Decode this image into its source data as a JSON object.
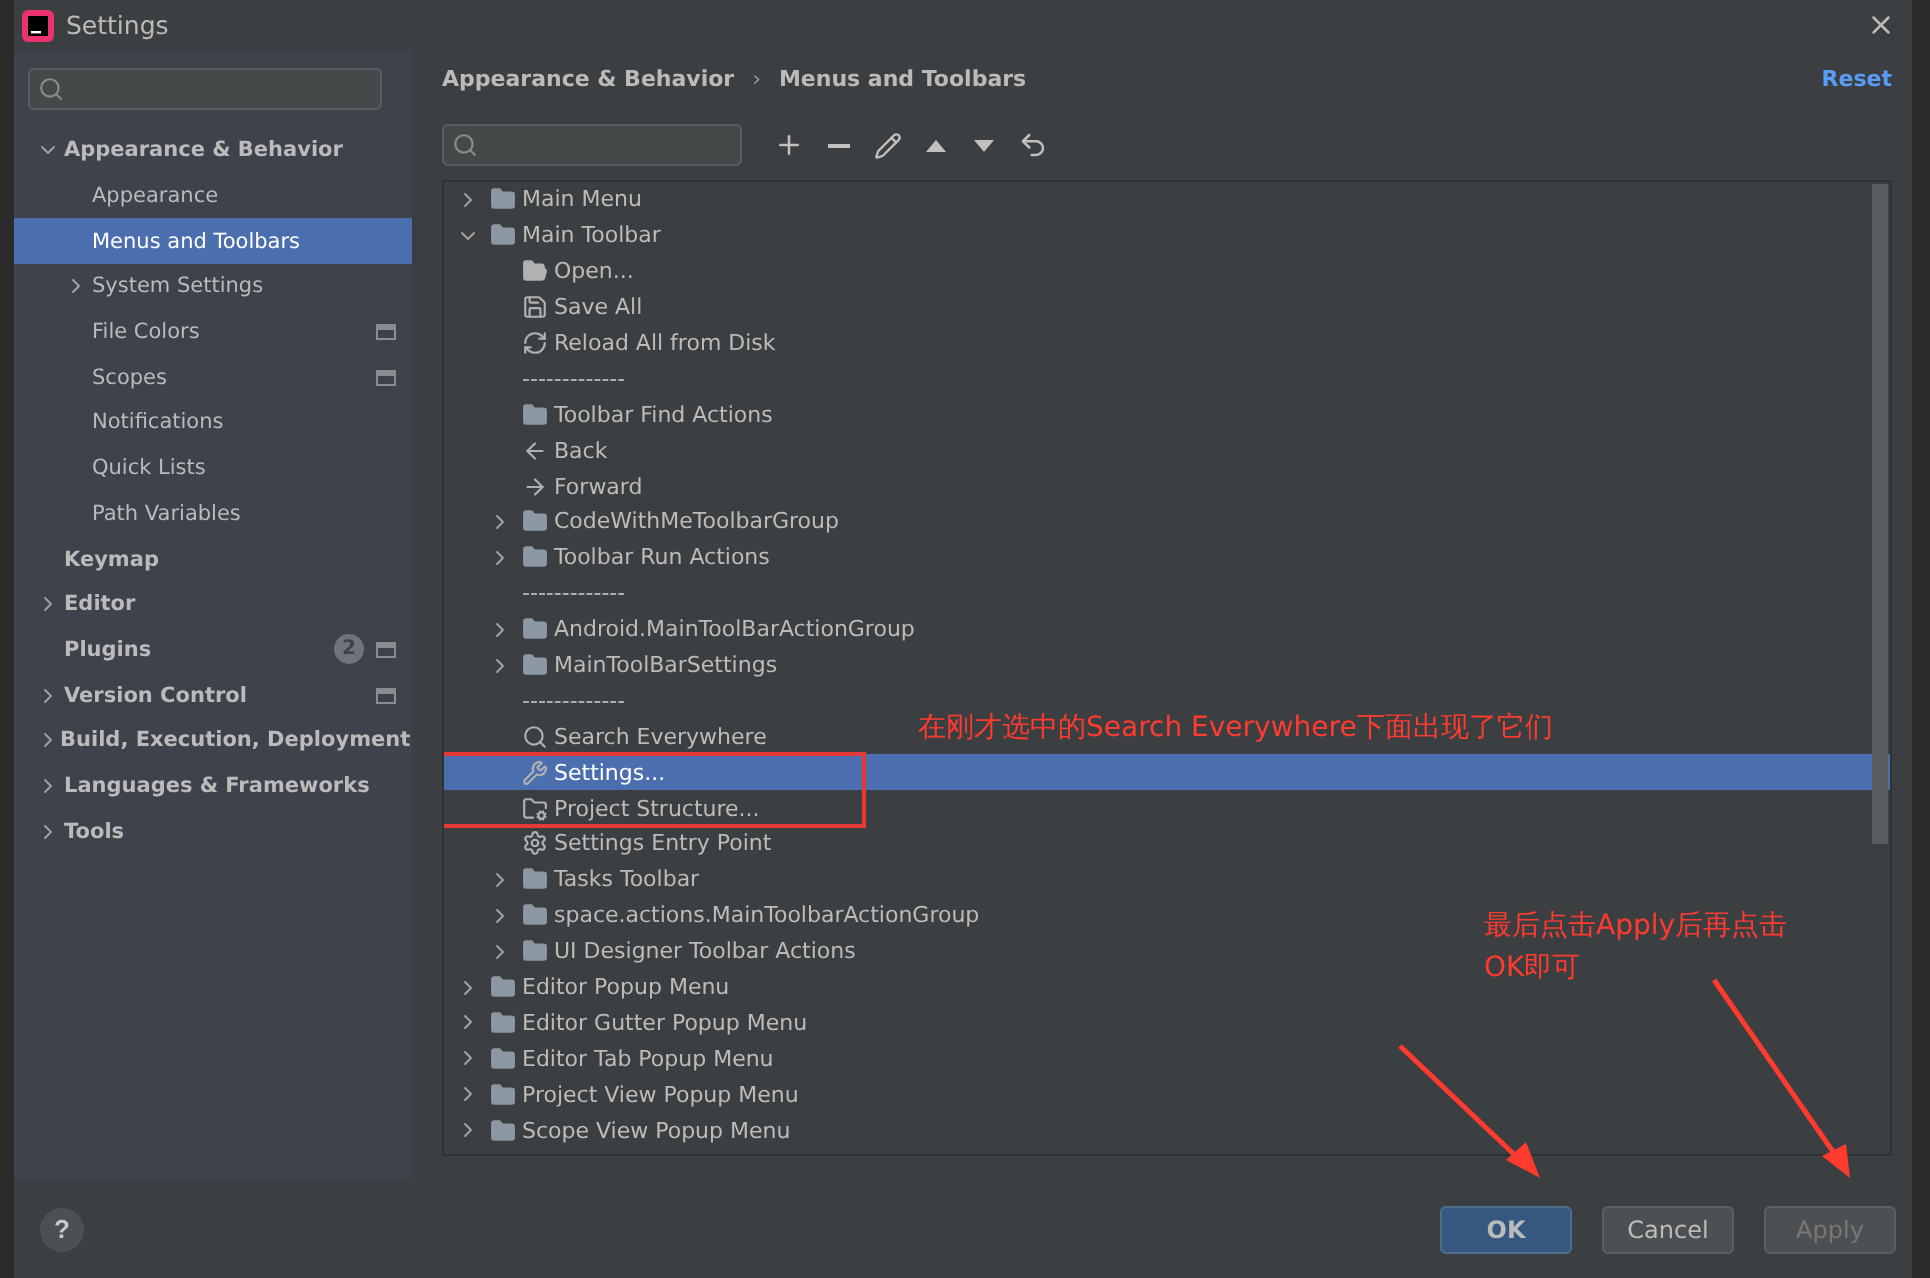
{
  "window": {
    "title": "Settings"
  },
  "sidebar": {
    "items": [
      {
        "label": "Appearance & Behavior",
        "expanded": true,
        "selected": false,
        "children": [
          {
            "label": "Appearance",
            "selected": false
          },
          {
            "label": "Menus and Toolbars",
            "selected": true
          },
          {
            "label": "System Settings",
            "expanded": false,
            "selected": false
          },
          {
            "label": "File Colors",
            "selected": false,
            "project_level": true
          },
          {
            "label": "Scopes",
            "selected": false,
            "project_level": true
          },
          {
            "label": "Notifications",
            "selected": false
          },
          {
            "label": "Quick Lists",
            "selected": false
          },
          {
            "label": "Path Variables",
            "selected": false
          }
        ]
      },
      {
        "label": "Keymap",
        "selected": false
      },
      {
        "label": "Editor",
        "expanded": false,
        "selected": false
      },
      {
        "label": "Plugins",
        "selected": false,
        "badge": "2",
        "project_level": true
      },
      {
        "label": "Version Control",
        "expanded": false,
        "selected": false,
        "project_level": true
      },
      {
        "label": "Build, Execution, Deployment",
        "expanded": false,
        "selected": false
      },
      {
        "label": "Languages & Frameworks",
        "expanded": false,
        "selected": false
      },
      {
        "label": "Tools",
        "expanded": false,
        "selected": false
      }
    ]
  },
  "breadcrumb": [
    "Appearance & Behavior",
    "Menus and Toolbars"
  ],
  "breadcrumb_separator": "›",
  "reset": "Reset",
  "tree": [
    {
      "kind": "folder",
      "label": "Main Menu",
      "expanded": false,
      "selected": false
    },
    {
      "kind": "folder",
      "label": "Main Toolbar",
      "expanded": true,
      "selected": false,
      "children": [
        {
          "kind": "open",
          "label": "Open...",
          "selected": false
        },
        {
          "kind": "save",
          "label": "Save All",
          "selected": false
        },
        {
          "kind": "reload",
          "label": "Reload All from Disk",
          "selected": false
        },
        {
          "kind": "separator",
          "label": "-------------",
          "selected": false
        },
        {
          "kind": "folder",
          "label": "Toolbar Find Actions",
          "selected": false
        },
        {
          "kind": "back",
          "label": "Back",
          "selected": false
        },
        {
          "kind": "forward",
          "label": "Forward",
          "selected": false
        },
        {
          "kind": "folder",
          "label": "CodeWithMeToolbarGroup",
          "expanded": false,
          "selected": false
        },
        {
          "kind": "folder",
          "label": "Toolbar Run Actions",
          "expanded": false,
          "selected": false
        },
        {
          "kind": "separator",
          "label": "-------------",
          "selected": false
        },
        {
          "kind": "folder",
          "label": "Android.MainToolBarActionGroup",
          "expanded": false,
          "selected": false
        },
        {
          "kind": "folder",
          "label": "MainToolBarSettings",
          "expanded": false,
          "selected": false
        },
        {
          "kind": "separator",
          "label": "-------------",
          "selected": false
        },
        {
          "kind": "search",
          "label": "Search Everywhere",
          "selected": false
        },
        {
          "kind": "wrench",
          "label": "Settings...",
          "selected": true,
          "boxed": true
        },
        {
          "kind": "structure",
          "label": "Project Structure...",
          "selected": false,
          "boxed": true
        },
        {
          "kind": "gear",
          "label": "Settings Entry Point",
          "selected": false
        },
        {
          "kind": "folder",
          "label": "Tasks Toolbar",
          "expanded": false,
          "selected": false
        },
        {
          "kind": "folder",
          "label": "space.actions.MainToolbarActionGroup",
          "expanded": false,
          "selected": false
        },
        {
          "kind": "folder",
          "label": "UI Designer Toolbar Actions",
          "expanded": false,
          "selected": false
        }
      ]
    },
    {
      "kind": "folder",
      "label": "Editor Popup Menu",
      "expanded": false,
      "selected": false
    },
    {
      "kind": "folder",
      "label": "Editor Gutter Popup Menu",
      "expanded": false,
      "selected": false
    },
    {
      "kind": "folder",
      "label": "Editor Tab Popup Menu",
      "expanded": false,
      "selected": false
    },
    {
      "kind": "folder",
      "label": "Project View Popup Menu",
      "expanded": false,
      "selected": false
    },
    {
      "kind": "folder",
      "label": "Scope View Popup Menu",
      "expanded": false,
      "selected": false
    }
  ],
  "annotations": [
    {
      "text": "在刚才选中的Search Everywhere下面出现了它们"
    },
    {
      "text": "最后点击Apply后再点击OK即可"
    }
  ],
  "footer": {
    "help": "?",
    "buttons": [
      {
        "label": "OK",
        "kind": "primary",
        "disabled": false
      },
      {
        "label": "Cancel",
        "kind": "normal",
        "disabled": false
      },
      {
        "label": "Apply",
        "kind": "normal",
        "disabled": true
      }
    ]
  }
}
